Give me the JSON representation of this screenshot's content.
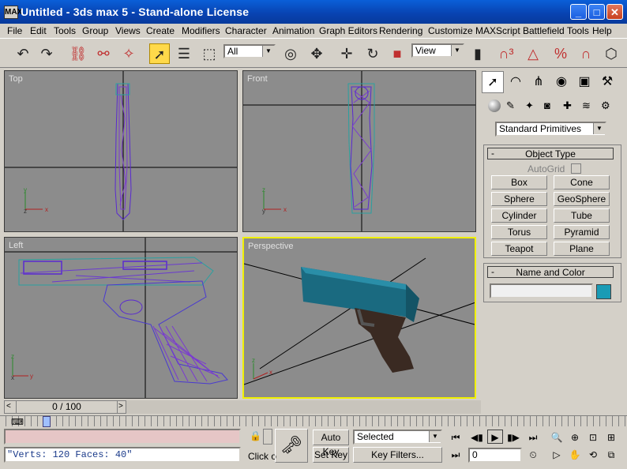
{
  "window": {
    "title": "Untitled - 3ds max 5 - Stand-alone License",
    "app_icon": "MAX",
    "min": "_",
    "max": "□",
    "close": "✕"
  },
  "menu": [
    "File",
    "Edit",
    "Tools",
    "Group",
    "Views",
    "Create",
    "Modifiers",
    "Character",
    "Animation",
    "Graph Editors",
    "Rendering",
    "Customize",
    "MAXScript",
    "Battlefield Tools",
    "Help"
  ],
  "toolbar": {
    "filter_value": "All",
    "refcoord_value": "View"
  },
  "viewports": {
    "top": "Top",
    "front": "Front",
    "left": "Left",
    "perspective": "Perspective"
  },
  "axis": {
    "x": "x",
    "y": "y",
    "z": "z"
  },
  "panel": {
    "category": "Standard Primitives",
    "object_type_title": "Object Type",
    "autogrid": "AutoGrid",
    "buttons": [
      "Box",
      "Cone",
      "Sphere",
      "GeoSphere",
      "Cylinder",
      "Tube",
      "Torus",
      "Pyramid",
      "Teapot",
      "Plane"
    ],
    "name_color_title": "Name and Color",
    "object_name": "",
    "object_color": "#1a9bb5",
    "minus": "-"
  },
  "timeline": {
    "slider": "0 / 100",
    "prev": "<",
    "next": ">"
  },
  "status": {
    "listener_text": "\"Verts: 120 Faces: 40\"",
    "prompt": "Click o",
    "auto_key": "Auto Key",
    "set_key": "Set Key",
    "selection_value": "Selected",
    "key_filters": "Key Filters...",
    "frame_value": "0"
  },
  "colors": {
    "wire_blue": "#4a3ad0",
    "wire_purple": "#8a3ad0",
    "wire_cyan": "#2aa0a0",
    "gun_body": "#1a6a80",
    "grip": "#3a2a22",
    "selected_viewport": "#f0f000"
  }
}
